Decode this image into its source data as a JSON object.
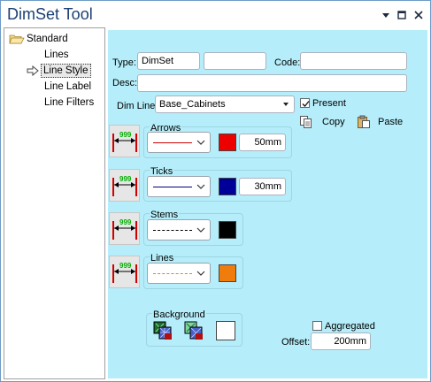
{
  "window": {
    "title": "DimSet Tool"
  },
  "tree": {
    "root": "Standard",
    "items": [
      "Lines",
      "Line Style",
      "Line Label",
      "Line Filters"
    ],
    "selected": "Line Style"
  },
  "form": {
    "type_label": "Type:",
    "type_value": "DimSet",
    "type2_value": "",
    "code_label": "Code:",
    "code_value": "",
    "desc_label": "Desc:",
    "desc_value": "",
    "dimline_label": "Dim Line:",
    "dimline_value": "Base_Cabinets",
    "present_label": "Present",
    "present_checked": true,
    "copy_label": "Copy",
    "paste_label": "Paste"
  },
  "groups": {
    "arrows": {
      "title": "Arrows",
      "line_color": "#cc0000",
      "line_style": "solid",
      "swatch": "#ee0000",
      "size": "50mm",
      "preview_label": "999"
    },
    "ticks": {
      "title": "Ticks",
      "line_color": "#000080",
      "line_style": "solid",
      "swatch": "#000099",
      "size": "30mm",
      "preview_label": "999"
    },
    "stems": {
      "title": "Stems",
      "line_color": "#000000",
      "line_style": "dashed",
      "swatch": "#000000",
      "preview_label": "999"
    },
    "lines": {
      "title": "Lines",
      "line_color": "#e08a00",
      "line_style": "dashed",
      "swatch": "#f07d0b",
      "preview_label": "999"
    }
  },
  "background": {
    "title": "Background",
    "swatch": "#ffffff"
  },
  "aggregated": {
    "label": "Aggregated",
    "checked": false
  },
  "offset": {
    "label": "Offset:",
    "value": "200mm"
  }
}
